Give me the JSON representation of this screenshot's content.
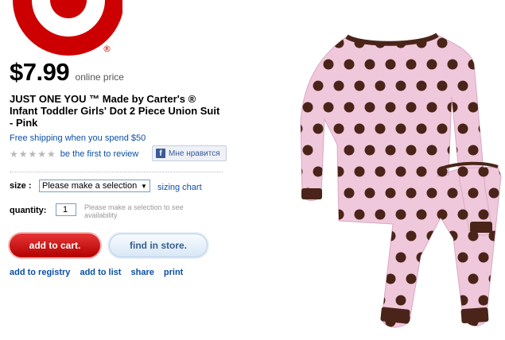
{
  "brand": {
    "logo": "target-bullseye-logo",
    "trademark": "®",
    "color": "#cc0000"
  },
  "price": {
    "amount": "$7.99",
    "note": "online price"
  },
  "product": {
    "title": "JUST ONE YOU ™ Made by Carter's ® Infant Toddler Girls' Dot 2 Piece Union Suit - Pink",
    "image": "pink-polka-dot-union-suit"
  },
  "shipping": {
    "text": "Free shipping when you spend $50"
  },
  "rating": {
    "stars": "★★★★★",
    "review_link": "be the first to review"
  },
  "social": {
    "like_label": "Мне нравится",
    "icon": "facebook-icon"
  },
  "size": {
    "label": "size :",
    "selected": "Please make a selection",
    "chart_link": "sizing chart"
  },
  "quantity": {
    "label": "quantity:",
    "value": "1",
    "note": "Please make a selection to see availability"
  },
  "actions": {
    "add_to_cart": "add to cart.",
    "find_in_store": "find in store."
  },
  "links": {
    "registry": "add to registry",
    "list": "add to list",
    "share": "share",
    "print": "print"
  },
  "colors": {
    "link": "#0a4fa6",
    "cart_button": "#cc0000",
    "garment": "#f0c8dc",
    "dots": "#4a2418"
  }
}
